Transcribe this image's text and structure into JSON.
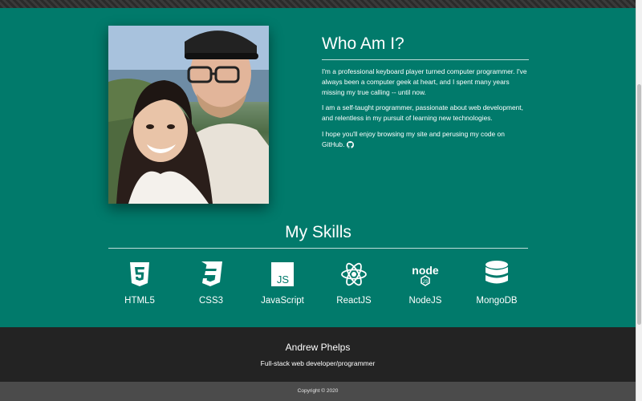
{
  "about": {
    "title": "Who Am I?",
    "paragraphs": [
      "I'm a professional keyboard player turned computer programmer. I've always been a computer geek at heart, and I spent many years missing my true calling -- until now.",
      "I am a self-taught programmer, passionate about web development, and relentless in my pursuit of learning new technologies.",
      "I hope you'll enjoy browsing my site and perusing my code on GitHub."
    ]
  },
  "skills": {
    "title": "My Skills",
    "items": [
      {
        "label": "HTML5",
        "icon": "html5-icon"
      },
      {
        "label": "CSS3",
        "icon": "css3-icon"
      },
      {
        "label": "JavaScript",
        "icon": "javascript-icon"
      },
      {
        "label": "ReactJS",
        "icon": "react-icon"
      },
      {
        "label": "NodeJS",
        "icon": "nodejs-icon"
      },
      {
        "label": "MongoDB",
        "icon": "database-icon"
      }
    ]
  },
  "footer": {
    "name": "Andrew Phelps",
    "tagline": "Full-stack web developer/programmer",
    "copyright": "Copyright © 2020"
  },
  "colors": {
    "main_bg": "#017a6b",
    "footer_bg": "#232323",
    "copyright_bg": "#4b4b4b"
  }
}
